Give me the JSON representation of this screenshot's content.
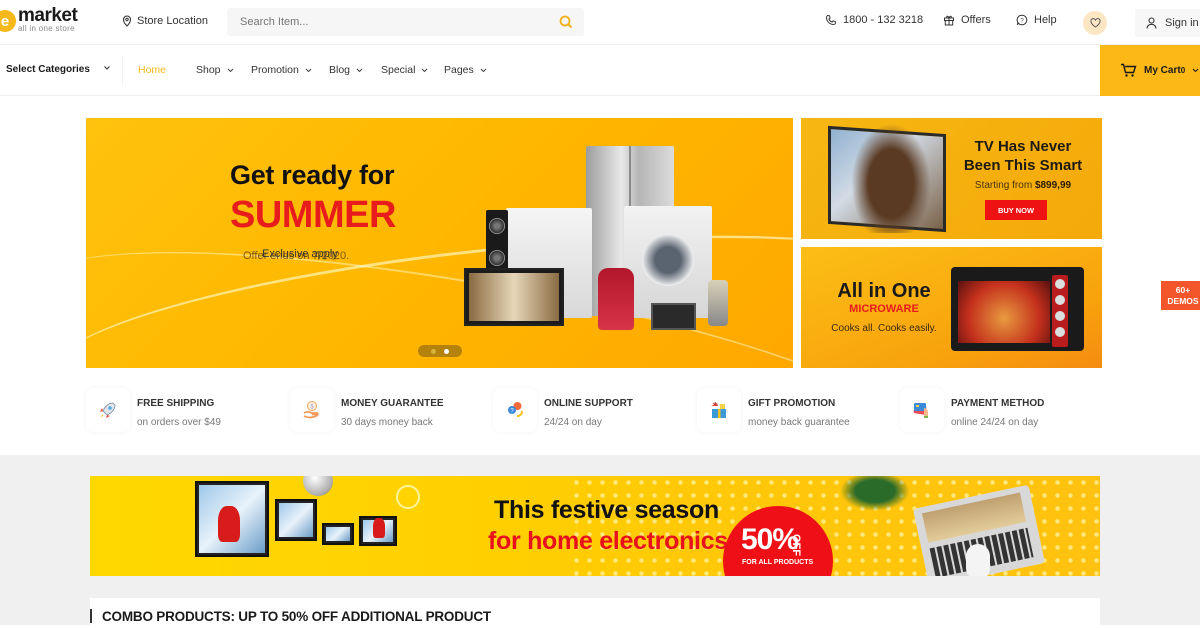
{
  "header": {
    "logo": {
      "title": "market",
      "subtitle": "all in one store",
      "mark": "e"
    },
    "store_location": "Store Location",
    "search": {
      "placeholder": "Search Item...",
      "value": ""
    },
    "phone": "1800 - 132 3218",
    "offers": "Offers",
    "help": "Help",
    "sign_in": "Sign in"
  },
  "nav": {
    "categories": "Select Categories",
    "items": [
      {
        "label": "Home",
        "active": true,
        "dropdown": false
      },
      {
        "label": "Shop",
        "dropdown": true
      },
      {
        "label": "Promotion",
        "dropdown": true
      },
      {
        "label": "Blog",
        "dropdown": true
      },
      {
        "label": "Special",
        "dropdown": true
      },
      {
        "label": "Pages",
        "dropdown": true
      }
    ],
    "cart": {
      "label": "My Cart",
      "count": "0"
    }
  },
  "hero": {
    "title": "Get ready for",
    "highlight": "SUMMER",
    "sub_behind": "Offer ends on 7/2020.",
    "sub_front": "Exclusive apply",
    "slides": 2,
    "active_slide": 2
  },
  "side_banners": [
    {
      "title": "TV Has Never Been This Smart",
      "price_prefix": "Starting from",
      "price": "$899,99",
      "button": "BUY NOW"
    },
    {
      "title": "All in One",
      "subtitle": "MICROWARE",
      "tagline": "Cooks all. Cooks easily."
    }
  ],
  "demos_badge": {
    "line1": "60+",
    "line2": "DEMOS"
  },
  "features": [
    {
      "icon": "rocket-icon",
      "title": "FREE SHIPPING",
      "subtitle": "on orders over $49"
    },
    {
      "icon": "money-hand-icon",
      "title": "MONEY GUARANTEE",
      "subtitle": "30 days money back"
    },
    {
      "icon": "support-chat-icon",
      "title": "ONLINE SUPPORT",
      "subtitle": "24/24 on day"
    },
    {
      "icon": "gift-icon",
      "title": "GIFT PROMOTION",
      "subtitle": "money back guarantee"
    },
    {
      "icon": "credit-card-icon",
      "title": "PAYMENT METHOD",
      "subtitle": "online 24/24 on day"
    }
  ],
  "promo_banner": {
    "line1": "This festive season",
    "line2": "for home electronics",
    "discount": "50%",
    "off": "OFF",
    "note": "FOR ALL PRODUCTS"
  },
  "combo": {
    "title": "COMBO PRODUCTS: UP TO 50% OFF ADDITIONAL PRODUCT"
  },
  "colors": {
    "accent": "#fbb817",
    "red": "#e81c1c",
    "demos": "#f2562a"
  }
}
